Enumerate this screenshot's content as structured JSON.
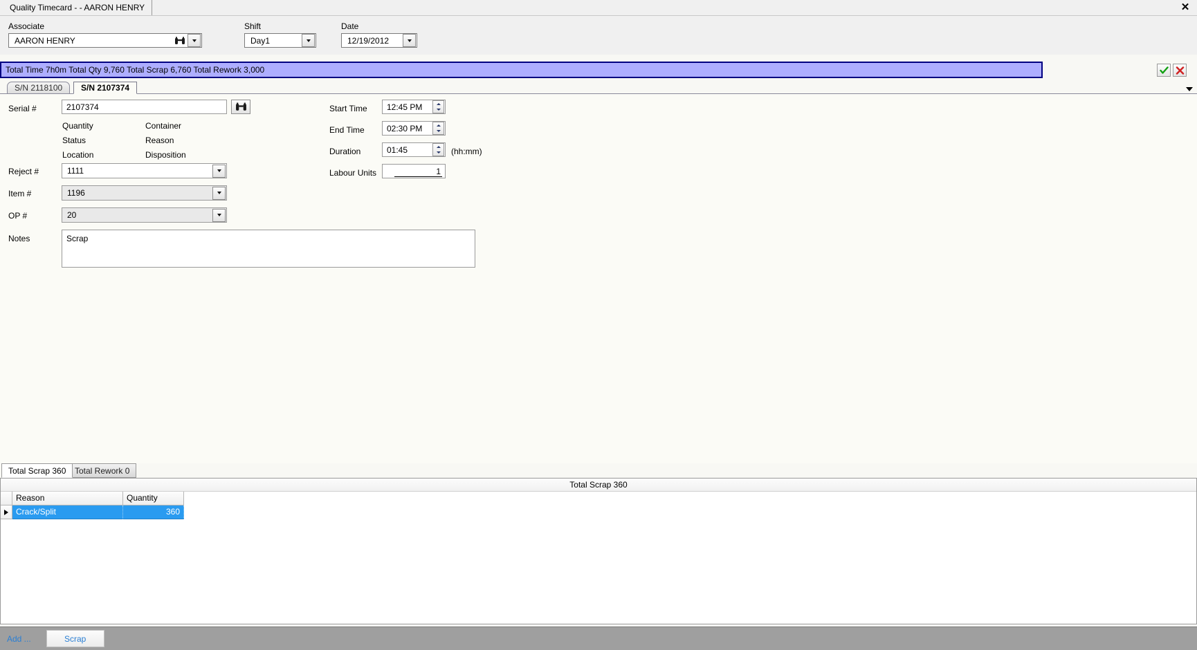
{
  "window": {
    "tab_title": "Quality Timecard - - AARON HENRY",
    "close_label": "✕"
  },
  "header": {
    "associate": {
      "label": "Associate",
      "value": "AARON HENRY",
      "search_icon": "binoculars-icon"
    },
    "shift": {
      "label": "Shift",
      "value": "Day1"
    },
    "date": {
      "label": "Date",
      "value": "12/19/2012"
    }
  },
  "summary": {
    "text": "Total Time 7h0m  Total Qty 9,760  Total Scrap 6,760 Total Rework 3,000",
    "accent_bg": "#aeaeff",
    "accent_border": "#000080",
    "ok_icon": "check-icon",
    "cancel_icon": "x-icon"
  },
  "serial_tabs": [
    {
      "label": "S/N 2118100",
      "active": false
    },
    {
      "label": "S/N 2107374",
      "active": true
    }
  ],
  "form": {
    "serial": {
      "label": "Serial #",
      "value": "2107374",
      "lookup_icon": "binoculars-icon"
    },
    "info_headers": {
      "quantity": "Quantity",
      "container": "Container",
      "status": "Status",
      "reason": "Reason",
      "location": "Location",
      "disposition": "Disposition"
    },
    "reject": {
      "label": "Reject #",
      "value": "1111"
    },
    "item": {
      "label": "Item #",
      "value": "1196"
    },
    "op": {
      "label": "OP #",
      "value": "20"
    },
    "notes": {
      "label": "Notes",
      "value": "Scrap"
    },
    "start_time": {
      "label": "Start Time",
      "value": "12:45 PM"
    },
    "end_time": {
      "label": "End Time",
      "value": "02:30 PM"
    },
    "duration": {
      "label": "Duration",
      "value": "01:45",
      "hint": "(hh:mm)"
    },
    "labour_units": {
      "label": "Labour Units",
      "value": "1"
    }
  },
  "detail_tabs": [
    {
      "label": "Total Scrap 360",
      "active": true
    },
    {
      "label": "Total Rework 0",
      "active": false
    }
  ],
  "grid": {
    "caption": "Total Scrap 360",
    "columns": [
      "Reason",
      "Quantity"
    ],
    "rows": [
      {
        "reason": "Crack/Split",
        "quantity": "360",
        "selected": true
      }
    ],
    "selection_color": "#2a9bf0"
  },
  "toolbar": {
    "add_label": "Add ...",
    "scrap_label": "Scrap",
    "link_color": "#2a7fd4"
  }
}
